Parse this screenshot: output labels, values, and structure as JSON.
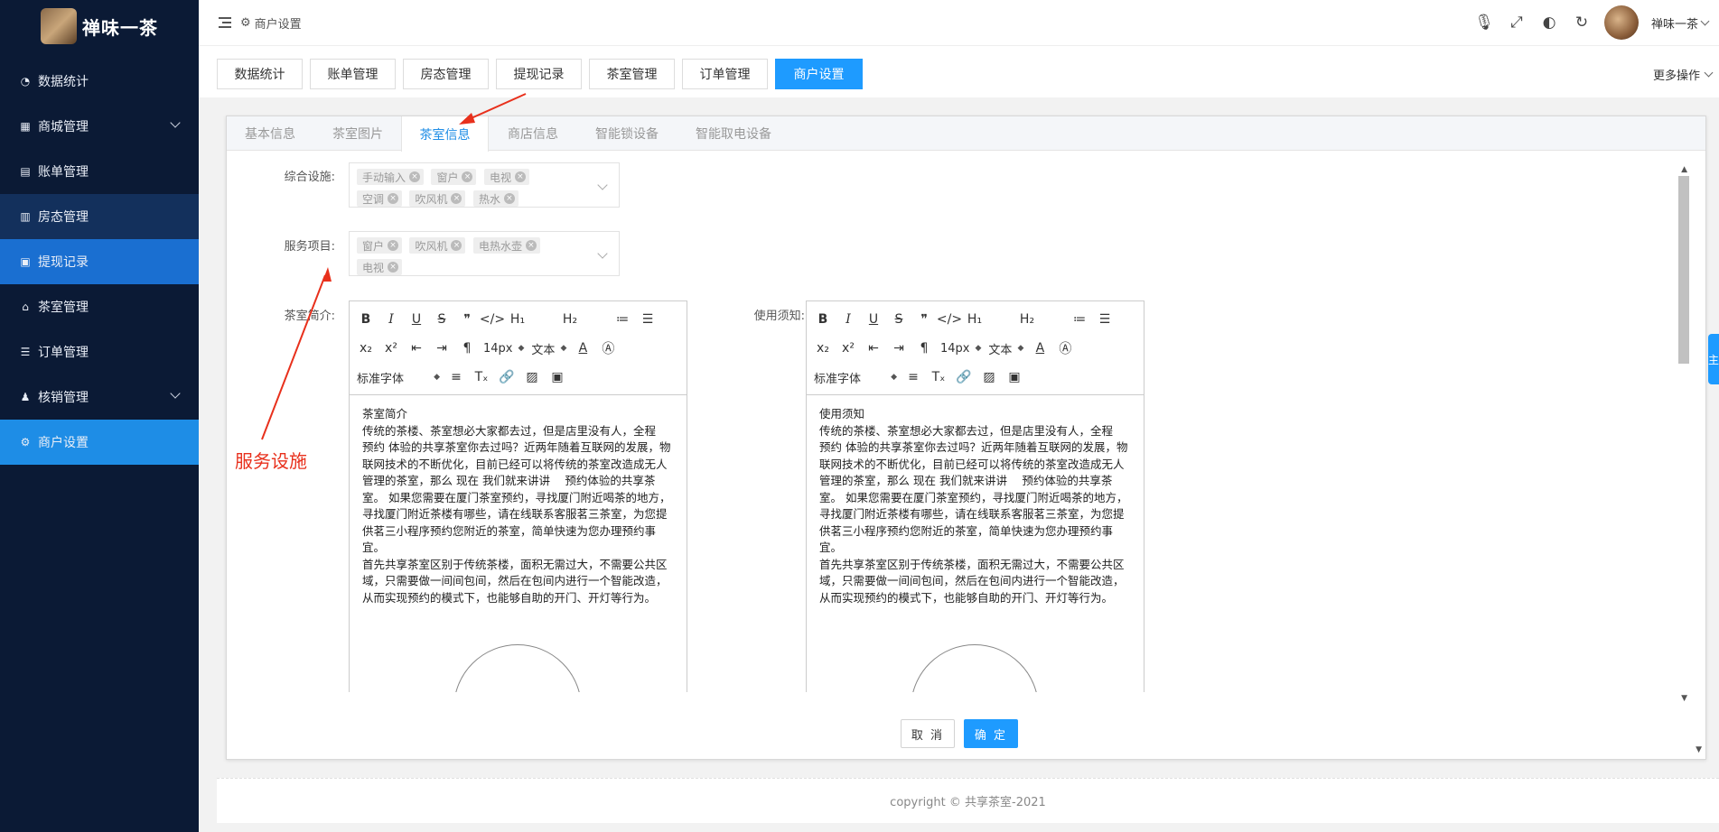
{
  "app": {
    "logo_text": "禅味一茶"
  },
  "sidebar": {
    "items": [
      {
        "label": "数据统计",
        "icon": "dashboard-icon",
        "glyph": "◔"
      },
      {
        "label": "商城管理",
        "icon": "shop-icon",
        "glyph": "▦"
      },
      {
        "label": "账单管理",
        "icon": "bill-icon",
        "glyph": "▤"
      },
      {
        "label": "房态管理",
        "icon": "building-icon",
        "glyph": "▥"
      },
      {
        "label": "提现记录",
        "icon": "money-icon",
        "glyph": "▣"
      },
      {
        "label": "茶室管理",
        "icon": "home-icon",
        "glyph": "⌂"
      },
      {
        "label": "订单管理",
        "icon": "list-icon",
        "glyph": "☰"
      },
      {
        "label": "核销管理",
        "icon": "user-icon",
        "glyph": "♟"
      },
      {
        "label": "商户设置",
        "icon": "gear-icon",
        "glyph": "⚙"
      }
    ]
  },
  "header": {
    "breadcrumb": "商户设置",
    "user_name": "禅味一茶"
  },
  "tabs": [
    "数据统计",
    "账单管理",
    "房态管理",
    "提现记录",
    "茶室管理",
    "订单管理",
    "商户设置"
  ],
  "more_ops": "更多操作",
  "subtabs": [
    "基本信息",
    "茶室图片",
    "茶室信息",
    "商店信息",
    "智能锁设备",
    "智能取电设备"
  ],
  "form": {
    "facilities_label": "综合设施:",
    "facilities": [
      "手动输入",
      "窗户",
      "电视",
      "空调",
      "吹风机",
      "热水"
    ],
    "services_label": "服务项目:",
    "services": [
      "窗户",
      "吹风机",
      "电热水壶",
      "电视"
    ],
    "intro_label": "茶室简介:",
    "notice_label": "使用须知:"
  },
  "editor": {
    "font_size": "14px",
    "text_type": "文本",
    "font_family": "标准字体",
    "intro_title": "茶室简介",
    "notice_title": "使用须知",
    "para1": "传统的茶楼、茶室想必大家都去过，但是店里没有人，全程　预约 体验的共享茶室你去过吗？近两年随着互联网的发展，物联网技术的不断优化，目前已经可以将传统的茶室改造成无人管理的茶室，那么 现在 我们就来讲讲　 预约体验的共享茶室。 如果您需要在厦门茶室预约，寻找厦门附近喝茶的地方，寻找厦门附近茶楼有哪些，请在线联系客服茗三茶室，为您提供茗三小程序预约您附近的茶室，简单快速为您办理预约事宜。",
    "para2": "首先共享茶室区别于传统茶楼，面积无需过大，不需要公共区域，只需要做一间间包间，然后在包间内进行一个智能改造，从而实现预约的模式下，也能够自助的开门、开灯等行为。"
  },
  "buttons": {
    "cancel": "取 消",
    "ok": "确 定"
  },
  "footer": "copyright © 共享茶室-2021",
  "annotation": "服务设施",
  "side_float": "主",
  "colors": {
    "sidebar_bg": "#0b1a35",
    "accent": "#1e9bff",
    "annotation": "#e8301c"
  }
}
